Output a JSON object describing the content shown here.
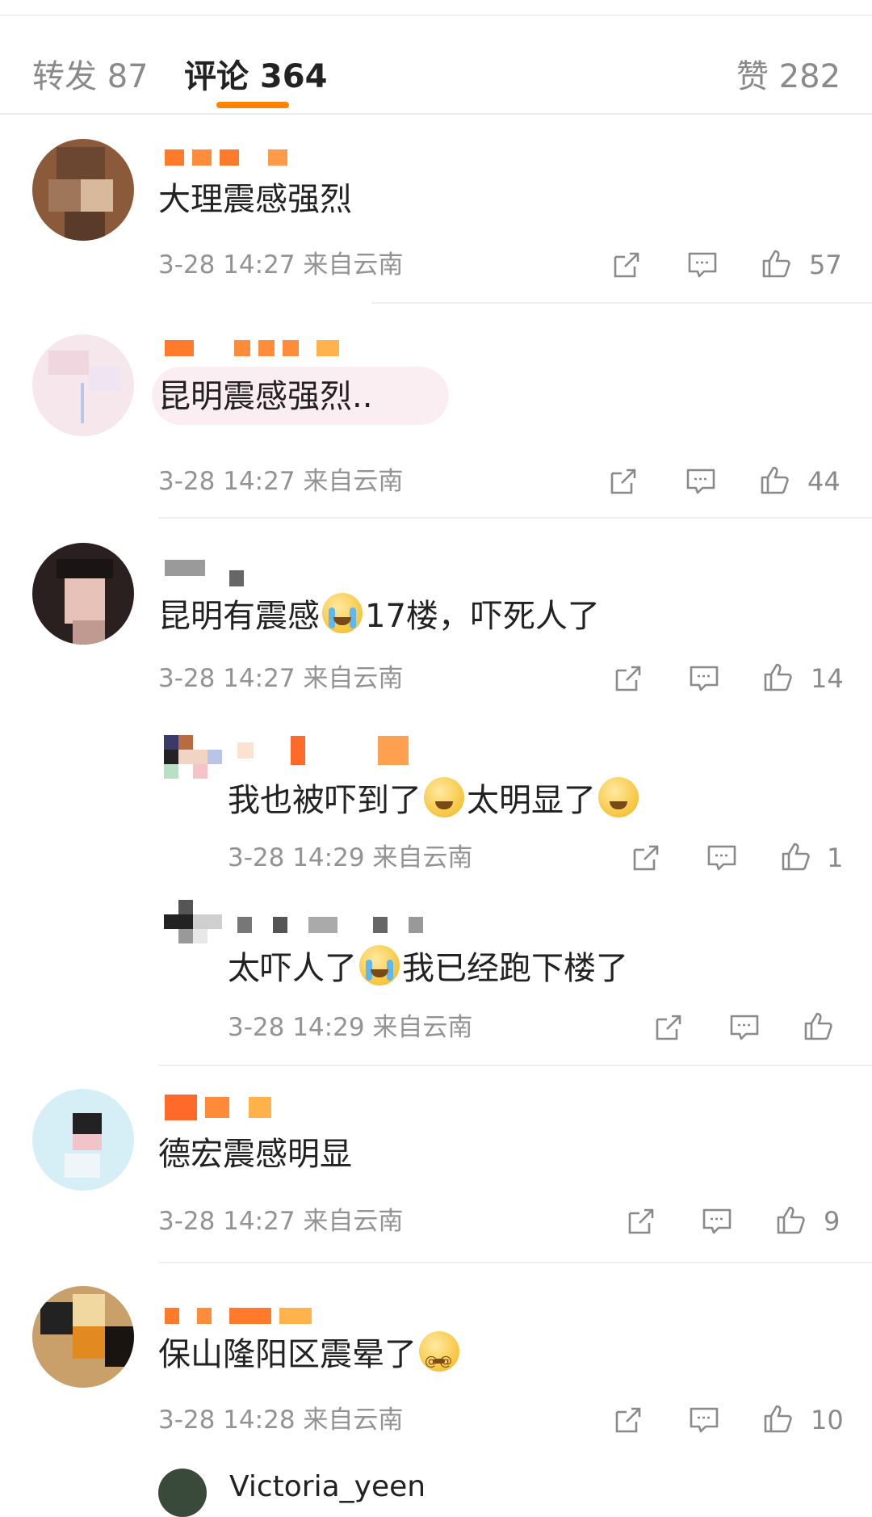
{
  "tabs": {
    "repost": "转发 87",
    "comments": "评论 364",
    "likes": "赞 282"
  },
  "comments": [
    {
      "text": "大理震感强烈",
      "meta": "3-28 14:27 来自云南",
      "likes": "57"
    },
    {
      "text": "昆明震感强烈..",
      "meta": "3-28 14:27 来自云南",
      "likes": "44"
    },
    {
      "text_before": "昆明有震感",
      "text_after": "17楼，吓死人了",
      "meta": "3-28 14:27 来自云南",
      "likes": "14",
      "replies": [
        {
          "text_a": "我也被吓到了",
          "text_b": "太明显了",
          "meta": "3-28 14:29 来自云南",
          "likes": "1"
        },
        {
          "text_a": "太吓人了",
          "text_b": "我已经跑下楼了",
          "meta": "3-28 14:29 来自云南",
          "likes": ""
        }
      ]
    },
    {
      "text": "德宏震感明显",
      "meta": "3-28 14:27 来自云南",
      "likes": "9"
    },
    {
      "text": "保山隆阳区震晕了",
      "meta": "3-28 14:28 来自云南",
      "likes": "10"
    },
    {
      "partial_name": "Victoria_yeen"
    }
  ],
  "icons": [
    "repost-icon",
    "reply-icon",
    "like-icon",
    "cry-emoji",
    "laugh-cry-emoji",
    "dizzy-emoji"
  ],
  "colors": {
    "accent": "#ff8200",
    "meta_gray": "#939393",
    "divider": "#efefef"
  }
}
